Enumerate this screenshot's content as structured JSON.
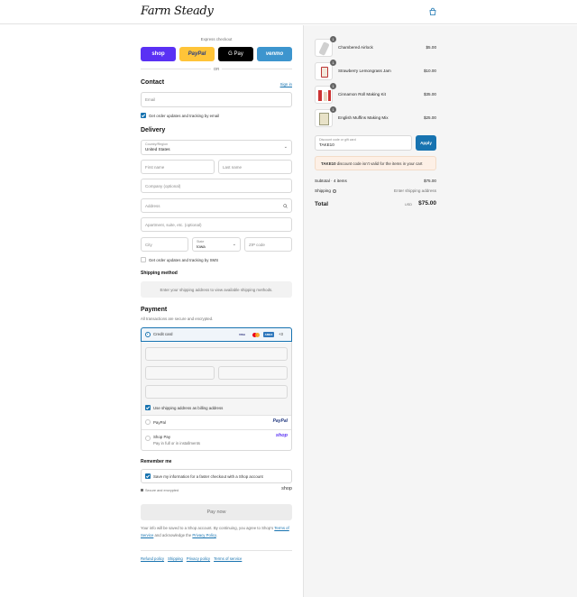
{
  "header": {
    "logo": "Farm Steady",
    "cart_icon": "shopping-bag-icon"
  },
  "express": {
    "title": "Express checkout",
    "buttons": [
      {
        "label": "shop",
        "bg": "#5a31f4",
        "fg": "#ffffff"
      },
      {
        "label": "PayPal",
        "bg": "#ffc439",
        "fg": "#253b80"
      },
      {
        "label": "G Pay",
        "bg": "#000000",
        "fg": "#ffffff"
      },
      {
        "label": "venmo",
        "bg": "#3d95ce",
        "fg": "#ffffff"
      }
    ],
    "or": "OR"
  },
  "contact": {
    "title": "Contact",
    "sign_in": "Sign in",
    "email_placeholder": "Email",
    "email_opt_in": "Get order updates and tracking by email"
  },
  "delivery": {
    "title": "Delivery",
    "country_label": "Country/Region",
    "country_value": "United States",
    "first_name": "First name",
    "last_name": "Last name",
    "company": "Company (optional)",
    "address": "Address",
    "apartment": "Apartment, suite, etc. (optional)",
    "city": "City",
    "state_label": "State",
    "state_value": "Iowa",
    "zip": "ZIP code",
    "sms_opt_in": "Get order updates and tracking by SMS"
  },
  "shipping": {
    "title": "Shipping method",
    "notice": "Enter your shipping address to view available shipping methods."
  },
  "payment": {
    "title": "Payment",
    "subtitle": "All transactions are secure and encrypted.",
    "credit_card": "Credit card",
    "brands": [
      "VISA",
      "MC",
      "AMEX"
    ],
    "more_brands": "+3",
    "billing_same": "Use shipping address as billing address",
    "paypal": "PayPal",
    "paypal_logo": "PayPal",
    "shop_pay": "Shop Pay",
    "shop_pay_sub": "Pay in full or in installments",
    "shop_pay_logo": "shop"
  },
  "remember": {
    "title": "Remember me",
    "save_info": "Save my information for a faster checkout with a Shop account",
    "secure": "Secure and encrypted",
    "shop_logo": "shop"
  },
  "pay_now": "Pay now",
  "legal": {
    "text_1": "Your info will be saved to a Shop account. By continuing, you agree to Shop’s",
    "terms": "Terms of Service",
    "text_2": "and acknowledge the",
    "privacy": "Privacy Policy",
    "text_3": "."
  },
  "footer_links": [
    "Refund policy",
    "Shipping",
    "Privacy policy",
    "Terms of service"
  ],
  "summary": {
    "products": [
      {
        "name": "Chambered Airlock",
        "qty": "1",
        "price": "$5.00"
      },
      {
        "name": "Strawberry Lemongrass Jam",
        "qty": "1",
        "price": "$10.00"
      },
      {
        "name": "Cinnamon Roll Making Kit",
        "qty": "1",
        "price": "$35.00"
      },
      {
        "name": "English Muffins Making Mix",
        "qty": "1",
        "price": "$25.00"
      }
    ],
    "discount_label": "Discount code or gift card",
    "discount_value": "TAKE10",
    "apply": "Apply",
    "error_code": "TAKE10",
    "error_text": "discount code isn’t valid for the items in your cart",
    "subtotal_label": "Subtotal · 4 items",
    "subtotal_value": "$75.00",
    "shipping_label": "Shipping",
    "shipping_value": "Enter shipping address",
    "total_label": "Total",
    "currency": "USD",
    "total_value": "$75.00"
  }
}
